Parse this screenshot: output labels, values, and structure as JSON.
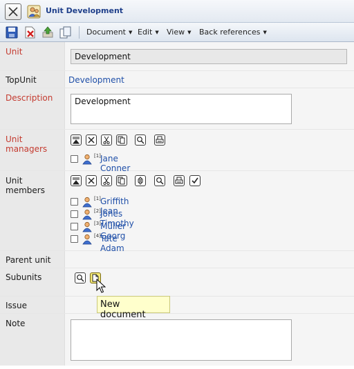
{
  "window": {
    "title": "Unit Development"
  },
  "toolbar": {
    "menus": [
      "Document",
      "Edit",
      "View",
      "Back references"
    ]
  },
  "fields": {
    "unit": {
      "label": "Unit",
      "value": "Development"
    },
    "topunit": {
      "label": "TopUnit",
      "value": "Development"
    },
    "description": {
      "label": "Description",
      "value": "Development"
    },
    "unit_managers": {
      "label": "Unit managers",
      "members": [
        {
          "index": "[1]",
          "name": "Jane Conner"
        }
      ]
    },
    "unit_members": {
      "label": "Unit members",
      "members": [
        {
          "index": "[1]",
          "name": "Griffith Jean"
        },
        {
          "index": "[2]",
          "name": "Jones Timothy"
        },
        {
          "index": "[3]",
          "name": "Müller Georg"
        },
        {
          "index": "[4]",
          "name": "Tate Adam"
        }
      ]
    },
    "parent_unit": {
      "label": "Parent unit"
    },
    "subunits": {
      "label": "Subunits"
    },
    "issue": {
      "label": "Issue"
    },
    "note": {
      "label": "Note",
      "value": ""
    }
  },
  "tooltip": {
    "text": "New document"
  },
  "icons": {
    "close": "close-icon",
    "unit": "unit-icon",
    "save": "save-icon",
    "delete": "delete-icon",
    "export": "export-icon",
    "copy": "copy-icon",
    "person": "person-icon",
    "first": "first-icon",
    "remove": "remove-icon",
    "cut": "cut-icon",
    "duplicate": "duplicate-icon",
    "search": "search-icon",
    "print": "print-icon",
    "sort": "sort-icon",
    "check": "check-icon",
    "new-document": "new-document-icon"
  },
  "colors": {
    "required_label": "#c43a2f",
    "link": "#1f4fa8",
    "title": "#1f3f8a",
    "tooltip_bg": "#ffffcc"
  }
}
